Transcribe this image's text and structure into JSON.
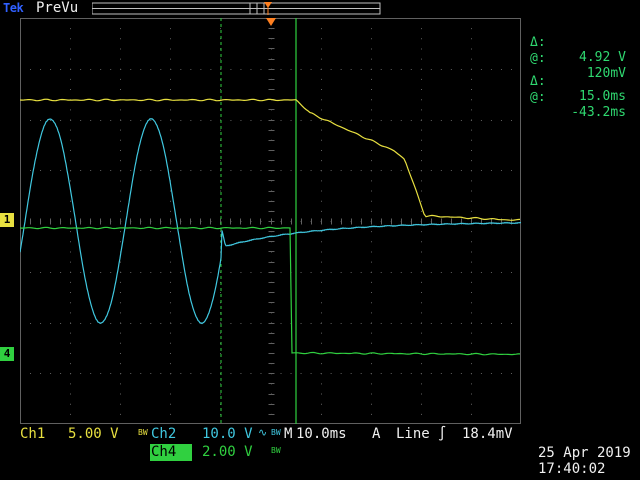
{
  "header": {
    "brand": "Tek",
    "mode": "PreVu"
  },
  "readouts": {
    "voltage_delta_symbol": "Δ:",
    "voltage_delta": "4.92 V",
    "voltage_at_symbol": "@:",
    "voltage_at": "120mV",
    "time_delta_symbol": "Δ:",
    "time_delta": "15.0ms",
    "time_at_symbol": "@:",
    "time_at": "-43.2ms"
  },
  "channels": {
    "ch1": {
      "name": "Ch1",
      "scale": "5.00 V",
      "coupling": "BW",
      "color": "#e8e040",
      "marker": "1"
    },
    "ch2": {
      "name": "Ch2",
      "scale": "10.0 V",
      "coupling": "BW",
      "color": "#40c8e0"
    },
    "ch4": {
      "name": "Ch4",
      "scale": "2.00 V",
      "coupling": "BW",
      "color": "#30d040",
      "marker": "4"
    }
  },
  "timebase": {
    "label": "M",
    "value": "10.0ms",
    "trigger_source_label": "A",
    "trigger_source": "Line",
    "trigger_level": "18.4mV"
  },
  "datetime": {
    "date": "25 Apr  2019",
    "time": "17:40:02"
  },
  "colors": {
    "grid": "#606060",
    "cursor": "#30d040",
    "trigger_marker": "#ff8020"
  }
}
